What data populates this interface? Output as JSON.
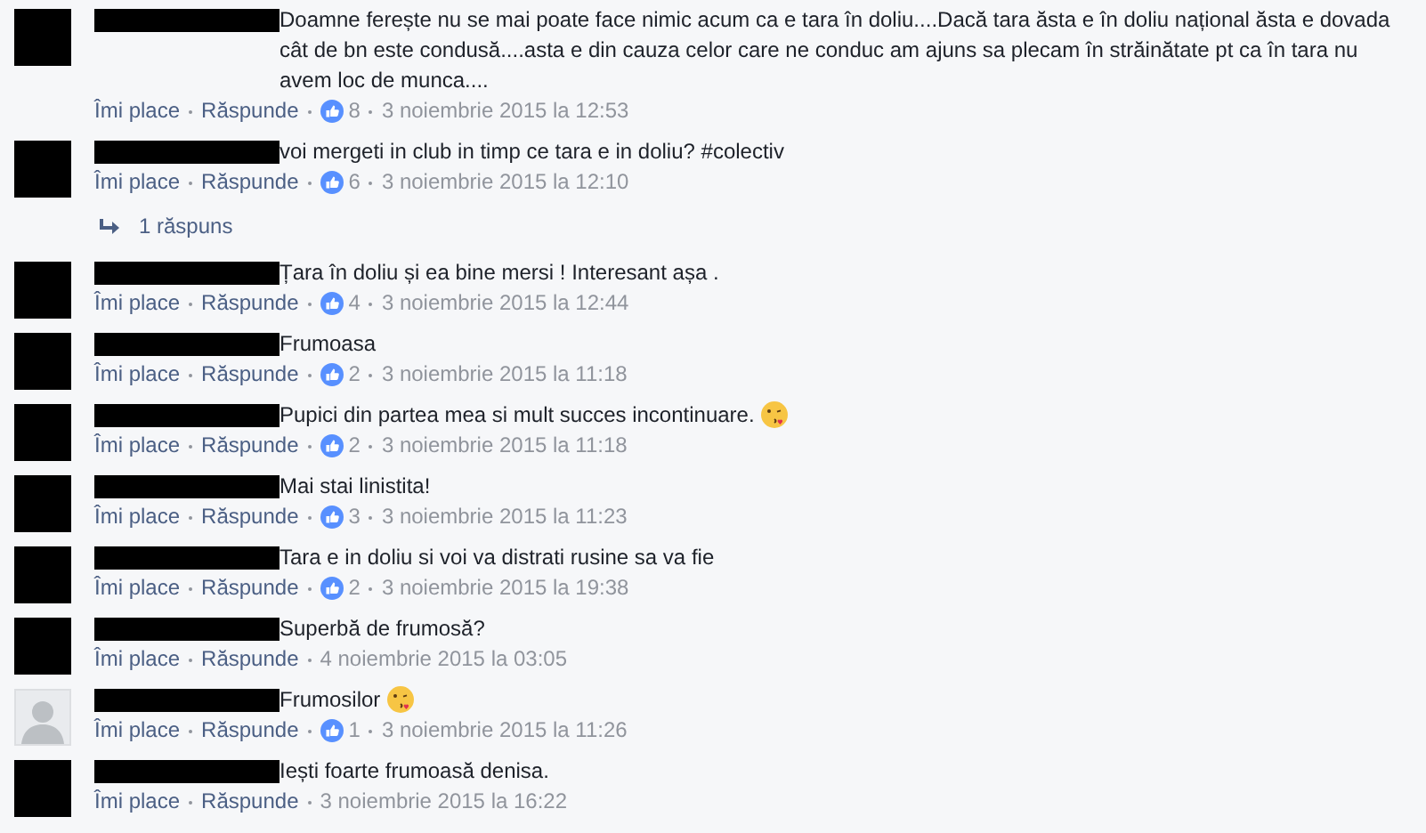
{
  "comments": [
    {
      "avatar": {
        "kind": "redacted"
      },
      "text": "Doamne ferește nu se mai poate face nimic acum ca e tara în doliu....Dacă tara ăsta e în doliu național ăsta e dovada cât de bn este condusă....asta e din cauza celor care ne conduc am ajuns sa plecam în străinătate pt ca în tara nu avem loc de munca....",
      "emoji": false,
      "like_action": "Îmi place",
      "reply_action": "Răspunde",
      "likes": "8",
      "date": "3 noiembrie 2015 la 12:53"
    },
    {
      "avatar": {
        "kind": "redacted"
      },
      "text": "voi mergeti in club in timp ce tara e in doliu? #colectiv",
      "emoji": false,
      "like_action": "Îmi place",
      "reply_action": "Răspunde",
      "likes": "6",
      "date": "3 noiembrie 2015 la 12:10",
      "replies": "1 răspuns"
    },
    {
      "avatar": {
        "kind": "redacted"
      },
      "text": "Țara în doliu și ea bine mersi ! Interesant așa .",
      "emoji": false,
      "like_action": "Îmi place",
      "reply_action": "Răspunde",
      "likes": "4",
      "date": "3 noiembrie 2015 la 12:44"
    },
    {
      "avatar": {
        "kind": "redacted"
      },
      "text": "Frumoasa",
      "emoji": false,
      "like_action": "Îmi place",
      "reply_action": "Răspunde",
      "likes": "2",
      "date": "3 noiembrie 2015 la 11:18"
    },
    {
      "avatar": {
        "kind": "redacted"
      },
      "text": "Pupici din partea mea si mult succes incontinuare.",
      "emoji": true,
      "like_action": "Îmi place",
      "reply_action": "Răspunde",
      "likes": "2",
      "date": "3 noiembrie 2015 la 11:18"
    },
    {
      "avatar": {
        "kind": "redacted"
      },
      "text": "Mai stai linistita!",
      "emoji": false,
      "like_action": "Îmi place",
      "reply_action": "Răspunde",
      "likes": "3",
      "date": "3 noiembrie 2015 la 11:23"
    },
    {
      "avatar": {
        "kind": "redacted"
      },
      "text": "Tara e in doliu si voi va distrati rusine sa va fie",
      "emoji": false,
      "like_action": "Îmi place",
      "reply_action": "Răspunde",
      "likes": "2",
      "date": "3 noiembrie 2015 la 19:38"
    },
    {
      "avatar": {
        "kind": "redacted"
      },
      "text": "Superbă de frumosă?",
      "emoji": false,
      "like_action": "Îmi place",
      "reply_action": "Răspunde",
      "date": "4 noiembrie 2015 la 03:05"
    },
    {
      "avatar": {
        "kind": "silhouette"
      },
      "text": "Frumosilor",
      "emoji": true,
      "like_action": "Îmi place",
      "reply_action": "Răspunde",
      "likes": "1",
      "date": "3 noiembrie 2015 la 11:26"
    },
    {
      "avatar": {
        "kind": "redacted"
      },
      "text": "Iești foarte frumoasă denisa.",
      "emoji": false,
      "like_action": "Îmi place",
      "reply_action": "Răspunde",
      "date": "3 noiembrie 2015 la 16:22"
    }
  ]
}
